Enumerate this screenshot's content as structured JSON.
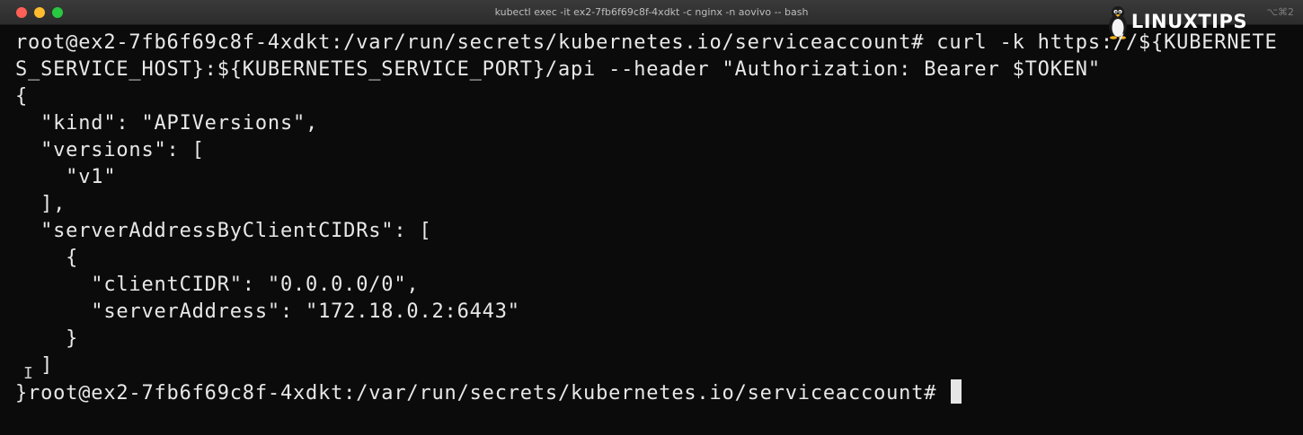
{
  "window": {
    "title": "kubectl exec -it ex2-7fb6f69c8f-4xdkt -c nginx -n aovivo -- bash",
    "shortcut": "⌥⌘2"
  },
  "logo": {
    "text": "LINUXTIPS",
    "icon": "tux-penguin-icon"
  },
  "terminal": {
    "lines": [
      "root@ex2-7fb6f69c8f-4xdkt:/var/run/secrets/kubernetes.io/serviceaccount# curl -k https://${KUBERNETE",
      "S_SERVICE_HOST}:${KUBERNETES_SERVICE_PORT}/api --header \"Authorization: Bearer $TOKEN\"",
      "{",
      "  \"kind\": \"APIVersions\",",
      "  \"versions\": [",
      "    \"v1\"",
      "  ],",
      "  \"serverAddressByClientCIDRs\": [",
      "    {",
      "      \"clientCIDR\": \"0.0.0.0/0\",",
      "      \"serverAddress\": \"172.18.0.2:6443\"",
      "    }",
      "  ]",
      "}root@ex2-7fb6f69c8f-4xdkt:/var/run/secrets/kubernetes.io/serviceaccount# "
    ]
  }
}
